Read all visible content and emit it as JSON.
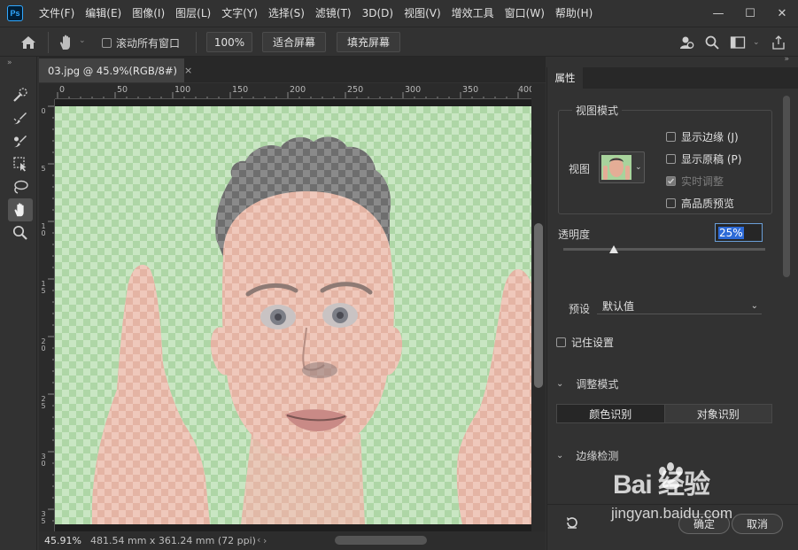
{
  "app": {
    "logo_text": "Ps",
    "menu": [
      "文件(F)",
      "编辑(E)",
      "图像(I)",
      "图层(L)",
      "文字(Y)",
      "选择(S)",
      "滤镜(T)",
      "3D(D)",
      "视图(V)",
      "增效工具",
      "窗口(W)",
      "帮助(H)"
    ],
    "window_controls": {
      "minimize": "—",
      "maximize": "☐",
      "close": "✕"
    }
  },
  "options_bar": {
    "scroll_all_windows_label": "滚动所有窗口",
    "scroll_all_windows_checked": false,
    "zoom_button": "100%",
    "fit_screen_button": "适合屏幕",
    "fill_screen_button": "填充屏幕"
  },
  "toolbar": {
    "tools": [
      "quick-selection-brush-icon",
      "refine-edge-brush-icon",
      "brush-icon",
      "object-selection-icon",
      "lasso-icon",
      "hand-icon",
      "zoom-icon"
    ],
    "active_tool": "hand-icon"
  },
  "document": {
    "tab_title": "03.jpg @ 45.9%(RGB/8#)",
    "tab_close": "×",
    "ruler_h": [
      "0",
      "50",
      "100",
      "150",
      "200",
      "250",
      "300",
      "350",
      "400"
    ],
    "ruler_v": [
      "0",
      "5",
      "1 0",
      "1 5",
      "2 0",
      "2 5",
      "3 0",
      "3 5"
    ],
    "status_zoom": "45.91%",
    "status_info": "481.54 mm x 361.24 mm (72 ppi)",
    "status_arrow": "›"
  },
  "properties_panel": {
    "tab": "属性",
    "view_mode_title": "视图模式",
    "view_label": "视图",
    "checks": [
      {
        "label": "显示边缘 (J)",
        "checked": false,
        "disabled": false
      },
      {
        "label": "显示原稿 (P)",
        "checked": false,
        "disabled": false
      },
      {
        "label": "实时调整",
        "checked": true,
        "disabled": true
      },
      {
        "label": "高品质预览",
        "checked": false,
        "disabled": false
      }
    ],
    "opacity_label": "透明度",
    "opacity_value": "25%",
    "opacity_percent": 25,
    "preset_label": "预设",
    "preset_value": "默认值",
    "remember_label": "记住设置",
    "adjust_mode_title": "调整模式",
    "adjust_mode_options": [
      "颜色识别",
      "对象识别"
    ],
    "adjust_mode_selected": "颜色识别",
    "edge_detection_title": "边缘检测",
    "ok_button": "确定",
    "cancel_button": "取消"
  },
  "watermark": {
    "logo": "Bai 经验",
    "url": "jingyan.baidu.com"
  }
}
